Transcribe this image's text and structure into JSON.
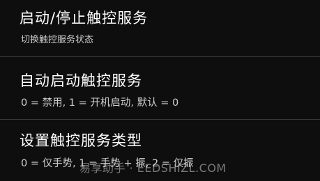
{
  "settings": {
    "items": [
      {
        "title": "启动/停止触控服务",
        "summary": "切换触控服务状态"
      },
      {
        "title": "自动启动触控服务",
        "summary": "0 = 禁用, 1 = 开机启动, 默认 = 0"
      },
      {
        "title": "设置触控服务类型",
        "summary": "0 = 仅手势, 1 = 手势 + 振, 2 = 仅振"
      }
    ]
  },
  "watermark": {
    "text": "易享助手 · EEDSHIZL.COM"
  },
  "colors": {
    "background": "#0e0e0e",
    "title": "#ffffff",
    "summary": "#cfcfcf",
    "divider": "#3a3a3a"
  }
}
